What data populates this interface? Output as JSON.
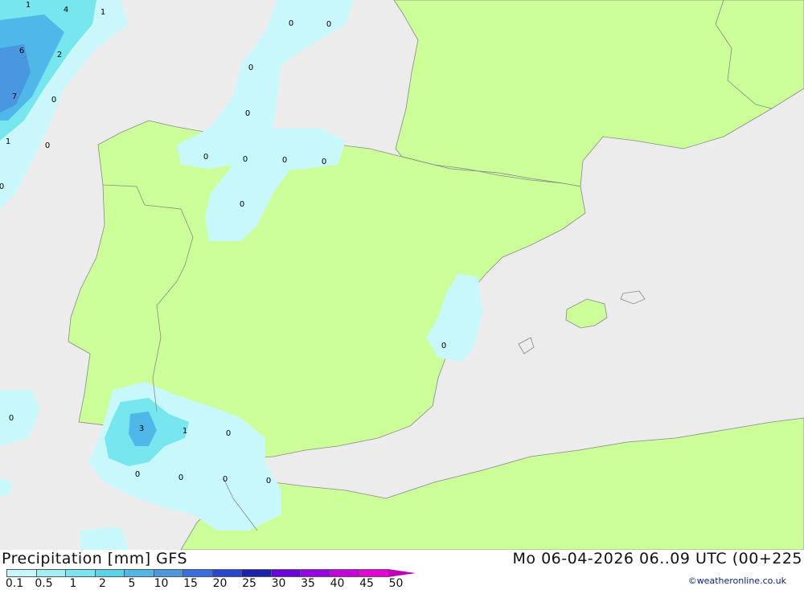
{
  "title": "Precipitation [mm] GFS",
  "datetime": "Mo 06-04-2026 06..09 UTC (00+225",
  "credit": "©weatheronline.co.uk",
  "colors": {
    "sea": "#ececec",
    "land": "#ccff99",
    "border": "#888888"
  },
  "legend": {
    "labels": [
      "0.1",
      "0.5",
      "1",
      "2",
      "5",
      "10",
      "15",
      "20",
      "25",
      "30",
      "35",
      "40",
      "45",
      "50"
    ],
    "colors": [
      "#c8f8fc",
      "#a0f0f4",
      "#78e6ee",
      "#58d4e8",
      "#50b8e8",
      "#4a96e0",
      "#3a6ee0",
      "#2846d0",
      "#1a22b0",
      "#6a00e0",
      "#9a00e8",
      "#c800e0",
      "#e800d8",
      "#c000b8"
    ]
  },
  "map_values": [
    "1",
    "4",
    "1",
    "6",
    "2",
    "7",
    "0",
    "1",
    "0",
    "0",
    "0",
    "0",
    "0",
    "0",
    "0",
    "0",
    "0",
    "0",
    "0",
    "0",
    "0",
    "3",
    "1",
    "0",
    "0",
    "0",
    "0",
    "0"
  ]
}
